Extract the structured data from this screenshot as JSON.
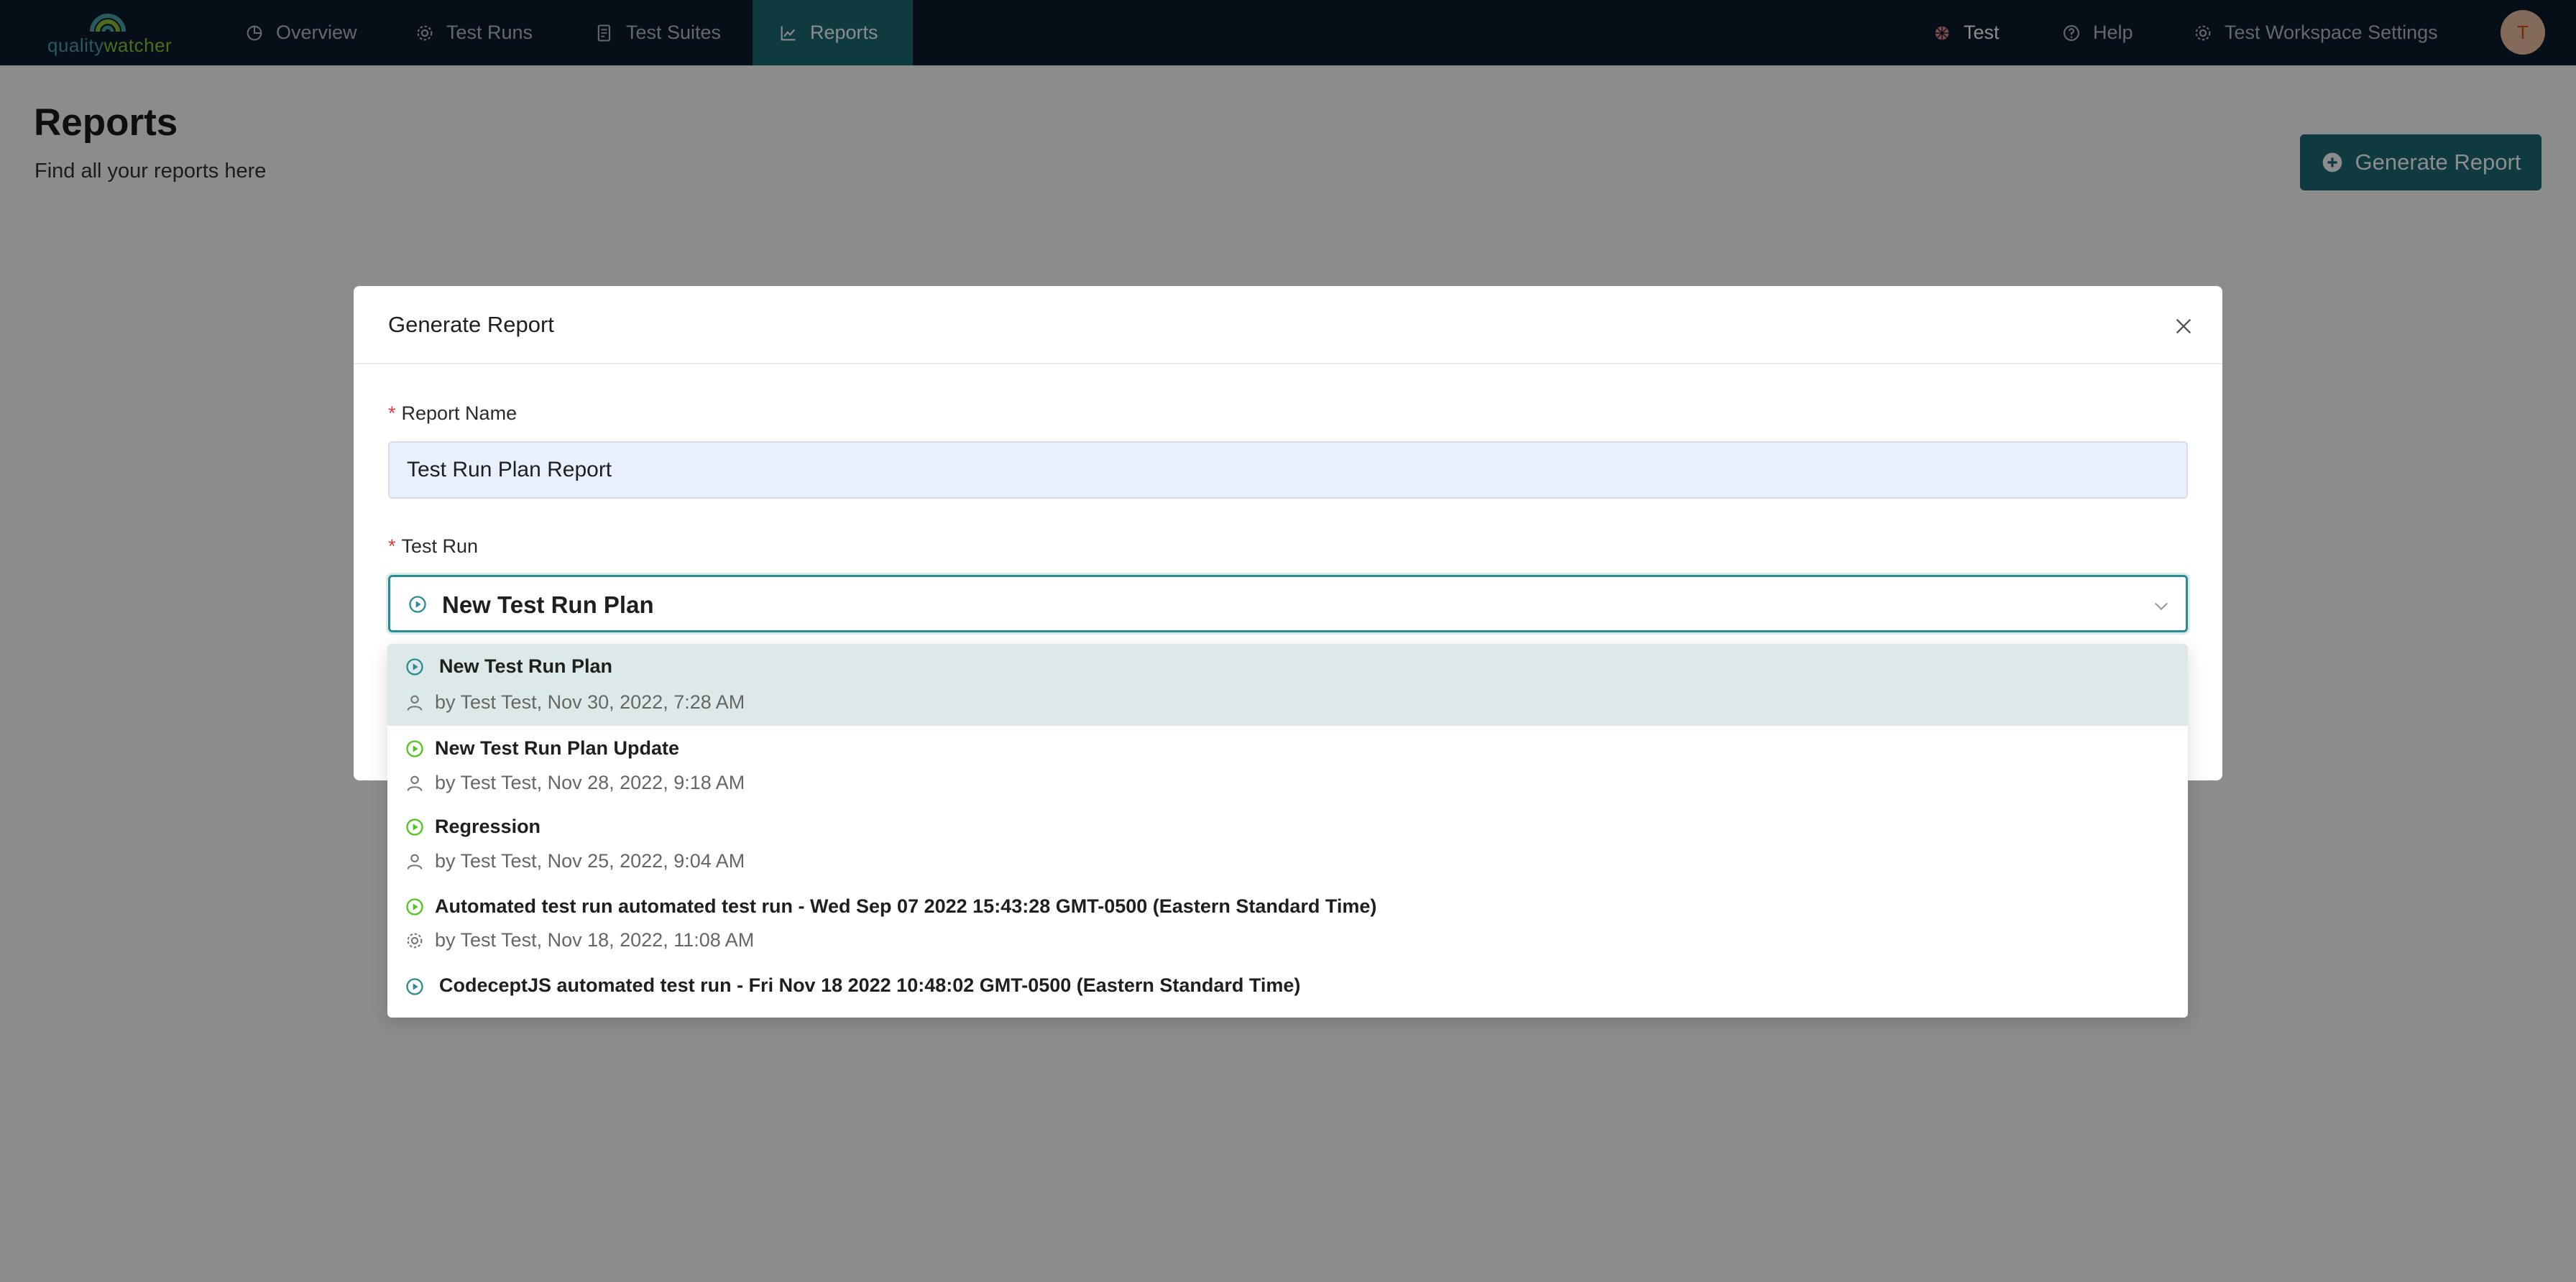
{
  "nav": {
    "logo_part1": "quality",
    "logo_part2": "watcher",
    "items": [
      {
        "label": "Overview"
      },
      {
        "label": "Test Runs"
      },
      {
        "label": "Test Suites"
      },
      {
        "label": "Reports"
      }
    ],
    "workspace_label": "Test",
    "help_label": "Help",
    "settings_label": "Test Workspace Settings",
    "avatar_initial": "T"
  },
  "page": {
    "title": "Reports",
    "subtitle": "Find all your reports here",
    "generate_button_label": "Generate Report"
  },
  "modal": {
    "title": "Generate Report",
    "report_name_label": "Report Name",
    "report_name_value": "Test Run Plan Report",
    "test_run_label": "Test Run",
    "test_run_selected": "New Test Run Plan"
  },
  "dropdown": {
    "options": [
      {
        "title": "New Test Run Plan",
        "meta": "by Test Test, Nov 30, 2022, 7:28 AM",
        "status_icon": "play-circle-icon",
        "author_icon": "user-icon",
        "color": "#2c8a94"
      },
      {
        "title": "New Test Run Plan Update",
        "meta": "by Test Test, Nov 28, 2022, 9:18 AM",
        "status_icon": "play-circle-icon",
        "author_icon": "user-icon",
        "color": "#52c41a"
      },
      {
        "title": "Regression",
        "meta": "by Test Test, Nov 25, 2022, 9:04 AM",
        "status_icon": "play-circle-icon",
        "author_icon": "user-icon",
        "color": "#52c41a"
      },
      {
        "title": "Automated test run automated test run - Wed Sep 07 2022 15:43:28 GMT-0500 (Eastern Standard Time)",
        "meta": "by Test Test, Nov 18, 2022, 11:08 AM",
        "status_icon": "play-circle-icon",
        "author_icon": "gear-icon",
        "color": "#52c41a"
      },
      {
        "title": "CodeceptJS automated test run - Fri Nov 18 2022 10:48:02 GMT-0500 (Eastern Standard Time)",
        "status_icon": "play-circle-icon",
        "color": "#2c8a94"
      }
    ]
  },
  "colors": {
    "nav_bg": "#0b1c2b",
    "accent": "#1b6b75",
    "focus": "#2c8a94",
    "success": "#52c41a",
    "required": "#e03b3b"
  }
}
